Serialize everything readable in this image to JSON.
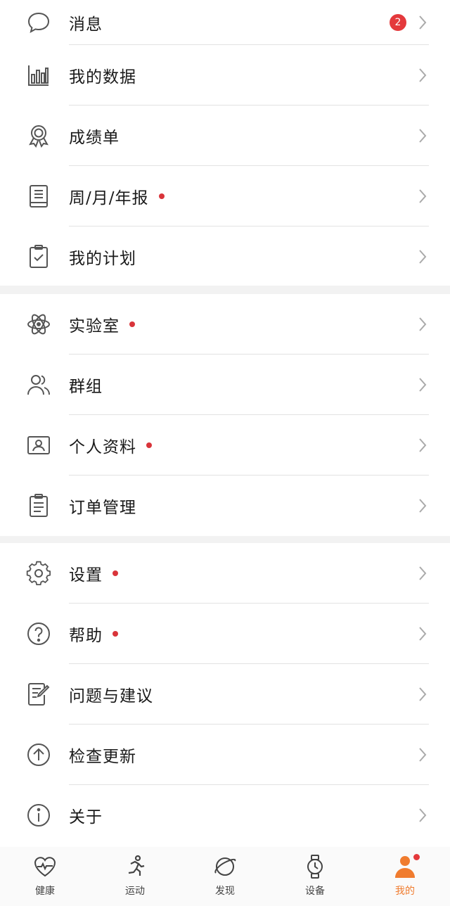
{
  "menu_groups": [
    {
      "items": [
        {
          "label": "消息",
          "icon": "message-bubble-icon",
          "badge": "2",
          "dot": false
        },
        {
          "label": "我的数据",
          "icon": "bar-chart-icon",
          "dot": false
        },
        {
          "label": "成绩单",
          "icon": "award-medal-icon",
          "dot": false
        },
        {
          "label": "周/月/年报",
          "icon": "report-book-icon",
          "dot": true
        },
        {
          "label": "我的计划",
          "icon": "clipboard-check-icon",
          "dot": false
        }
      ]
    },
    {
      "items": [
        {
          "label": "实验室",
          "icon": "atom-lab-icon",
          "dot": true
        },
        {
          "label": "群组",
          "icon": "group-users-icon",
          "dot": false
        },
        {
          "label": "个人资料",
          "icon": "profile-card-icon",
          "dot": true
        },
        {
          "label": "订单管理",
          "icon": "order-list-icon",
          "dot": false
        }
      ]
    },
    {
      "items": [
        {
          "label": "设置",
          "icon": "gear-icon",
          "dot": true
        },
        {
          "label": "帮助",
          "icon": "help-circle-icon",
          "dot": true
        },
        {
          "label": "问题与建议",
          "icon": "feedback-edit-icon",
          "dot": false
        },
        {
          "label": "检查更新",
          "icon": "update-arrow-icon",
          "dot": false
        },
        {
          "label": "关于",
          "icon": "info-circle-icon",
          "dot": false
        }
      ]
    }
  ],
  "tabbar": {
    "tabs": [
      {
        "label": "健康",
        "icon": "heart-pulse-icon",
        "active": false
      },
      {
        "label": "运动",
        "icon": "running-person-icon",
        "active": false
      },
      {
        "label": "发现",
        "icon": "planet-icon",
        "active": false
      },
      {
        "label": "设备",
        "icon": "watch-icon",
        "active": false
      },
      {
        "label": "我的",
        "icon": "person-icon",
        "active": true,
        "dot": true
      }
    ]
  },
  "colors": {
    "accent": "#f07c2f",
    "badge": "#e4393c",
    "dot": "#d9343a",
    "icon_stroke": "#555555"
  }
}
